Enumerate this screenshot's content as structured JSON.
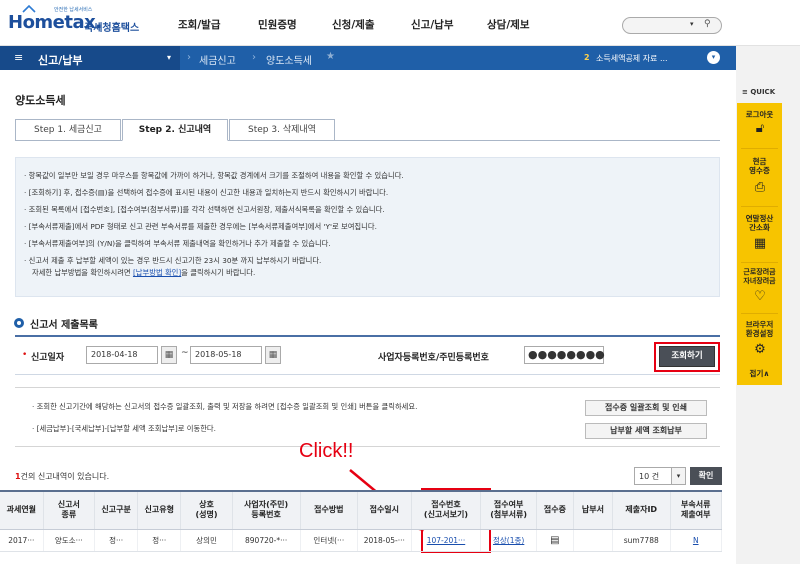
{
  "header": {
    "slogan": "안전한 납세서비스",
    "logo_text": "Hometax.",
    "logo_sub": "국세청홈택스",
    "gnb": [
      "조회/발급",
      "민원증명",
      "신청/제출",
      "신고/납부",
      "상담/제보"
    ]
  },
  "nav": {
    "menu_label": "신고/납부",
    "crumb1": "세금신고",
    "crumb2": "양도소득세",
    "notice_num": "2",
    "notice_text": "소득세액공제 자료 ..."
  },
  "quick": {
    "title": "QUICK",
    "items": [
      "로그아웃",
      "현금\n영수증",
      "연말정산\n간소화",
      "근로장려금\n자녀장려금",
      "브라우저\n환경설정"
    ],
    "close": "접기∧"
  },
  "page": {
    "title": "양도소득세",
    "tabs": [
      "Step 1. 세금신고",
      "Step 2. 신고내역",
      "Step 3. 삭제내역"
    ]
  },
  "notice": {
    "lines": [
      "항목값이 일부만 보일 경우 마우스를 항목값에 가까이 하거나, 항목값 경계에서 크기를 조절하여 내용을 확인할 수 있습니다.",
      "[조회하기] 후, 접수증(▤)을 선택하여 접수증에 표시된 내용이 신고한 내용과 일치하는지 반드시 확인하시기 바랍니다.",
      "조회된 목록에서 [접수번호], [접수여부(첨부서류)]를 각각 선택하면 신고서원장, 제출서식목록을 확인할 수 있습니다.",
      "[부속서류제출]에서 PDF 형태로 신고 관련 부속서류를 제출한 경우에는 [부속서류제출여부]에서 'Y'로 보여집니다.",
      "[부속서류제출여부]의 (Y/N)을 클릭하여 부속서류 제출내역을 확인하거나 추가 제출할 수 있습니다.",
      "신고서 제출 후 납부할 세액이 있는 경우 반드시 신고기한 23시 30분 까지 납부하시기 바랍니다."
    ],
    "last_pre": "자세한 납부방법을 확인하시려면 ",
    "last_link": "[납부방법 확인]",
    "last_post": "을 클릭하시기 바랍니다."
  },
  "search": {
    "section_title": "신고서 제출목록",
    "date_label": "신고일자",
    "date_from": "2018-04-18",
    "date_to": "2018-05-18",
    "id_label": "사업자등록번호/주민등록번호",
    "id_value": "●●●●●●●●",
    "search_btn": "조회하기"
  },
  "info2": {
    "line1": "· 조회한 신고기간에 해당하는 신고서의 접수증 일괄조회, 출력 및 저장을 하려면 [접수증 일괄조회 및 인쇄] 버튼을 클릭하세요.",
    "line2": "· [세금납부]-[국세납부]-[납부할 세액 조회납부]로 이동한다.",
    "btn1": "접수증 일괄조회 및 인쇄",
    "btn2": "납부할 세액 조회납부"
  },
  "annotation": {
    "click": "Click!!"
  },
  "results": {
    "count_num": "1",
    "count_text": "건의 신고내역이 있습니다.",
    "page_size": "10 건",
    "confirm": "확인",
    "headers": [
      "과세연월",
      "신고서\n종류",
      "신고구분",
      "신고유형",
      "상호\n(성명)",
      "사업자(주민)\n등록번호",
      "접수방법",
      "접수일시",
      "접수번호\n(신고서보기)",
      "접수여부\n(첨부서류)",
      "접수증",
      "납부서",
      "제출자ID",
      "부속서류\n제출여부"
    ],
    "row": [
      "2017···",
      "양도소···",
      "정···",
      "정···",
      "상의민",
      "890720-*···",
      "인터넷(···",
      "2018-05-···",
      "107-201···",
      "정상(1종)",
      "▤",
      "",
      "sum7788",
      "N"
    ]
  },
  "colors": {
    "brand": "#1f5fa8",
    "highlight": "#e60012",
    "quick_bg": "#f7c400"
  }
}
